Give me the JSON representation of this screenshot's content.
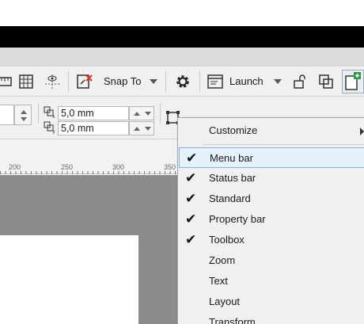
{
  "toolbar": {
    "snap_label": "Snap To",
    "launch_label": "Launch"
  },
  "property_bar": {
    "duplicate_x_value": "5,0 mm",
    "duplicate_y_value": "5,0 mm"
  },
  "ruler": {
    "ticks": [
      "200",
      "250",
      "300",
      "350"
    ]
  },
  "context_menu": {
    "customize_label": "Customize",
    "items": [
      {
        "label": "Menu bar",
        "checked": true
      },
      {
        "label": "Status bar",
        "checked": true
      },
      {
        "label": "Standard",
        "checked": true
      },
      {
        "label": "Property bar",
        "checked": true
      },
      {
        "label": "Toolbox",
        "checked": true
      },
      {
        "label": "Zoom",
        "checked": false
      },
      {
        "label": "Text",
        "checked": false
      },
      {
        "label": "Layout",
        "checked": false
      },
      {
        "label": "Transform",
        "checked": false
      }
    ],
    "check_glyph": "✔"
  }
}
